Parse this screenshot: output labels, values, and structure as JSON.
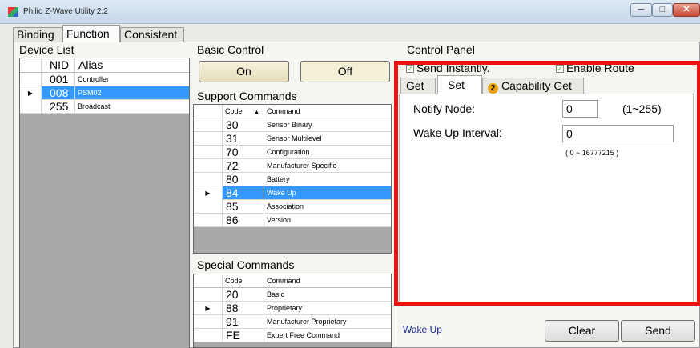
{
  "window": {
    "title": "Philio Z-Wave Utility 2.2",
    "min": "─",
    "max": "□",
    "close": "✕"
  },
  "tabs": [
    {
      "label": "Binding"
    },
    {
      "label": "Function"
    },
    {
      "label": "Consistent"
    }
  ],
  "device_list": {
    "title": "Device List",
    "columns": [
      "NID",
      "Alias"
    ],
    "rows": [
      {
        "nid": "001",
        "alias": "Controller"
      },
      {
        "nid": "008",
        "alias": "PSM02"
      },
      {
        "nid": "255",
        "alias": "Broadcast"
      }
    ]
  },
  "basic_control": {
    "title": "Basic Control",
    "on": "On",
    "off": "Off"
  },
  "support_commands": {
    "title": "Support Commands",
    "columns": [
      "Code",
      "Command"
    ],
    "sort_glyph": "▲",
    "rows": [
      {
        "code": "30",
        "command": "Sensor Binary"
      },
      {
        "code": "31",
        "command": "Sensor Multilevel"
      },
      {
        "code": "70",
        "command": "Configuration"
      },
      {
        "code": "72",
        "command": "Manufacturer Specific"
      },
      {
        "code": "80",
        "command": "Battery"
      },
      {
        "code": "84",
        "command": "Wake Up"
      },
      {
        "code": "85",
        "command": "Association"
      },
      {
        "code": "86",
        "command": "Version"
      }
    ]
  },
  "special_commands": {
    "title": "Special Commands",
    "columns": [
      "Code",
      "Command"
    ],
    "rows": [
      {
        "code": "20",
        "command": "Basic"
      },
      {
        "code": "88",
        "command": "Proprietary"
      },
      {
        "code": "91",
        "command": "Manufacturer Proprietary"
      },
      {
        "code": "FE",
        "command": "Expert Free Command"
      }
    ]
  },
  "control_panel": {
    "title": "Control Panel",
    "send_instantly": "Send Instantly.",
    "enable_route": "Enable Route",
    "check": "✓",
    "tabs": {
      "get": "Get",
      "set": "Set",
      "capability_icon": "2",
      "capability": "Capability Get"
    },
    "notify_label": "Notify Node:",
    "notify_value": "0",
    "notify_range": "(1~255)",
    "wakeup_label": "Wake Up Interval:",
    "wakeup_value": "0",
    "wakeup_range": "( 0 ~ 16777215 )",
    "status": "Wake Up",
    "clear": "Clear",
    "send": "Send"
  },
  "colors": {
    "selection": "#3399ff",
    "highlight_frame": "#ee1111"
  }
}
